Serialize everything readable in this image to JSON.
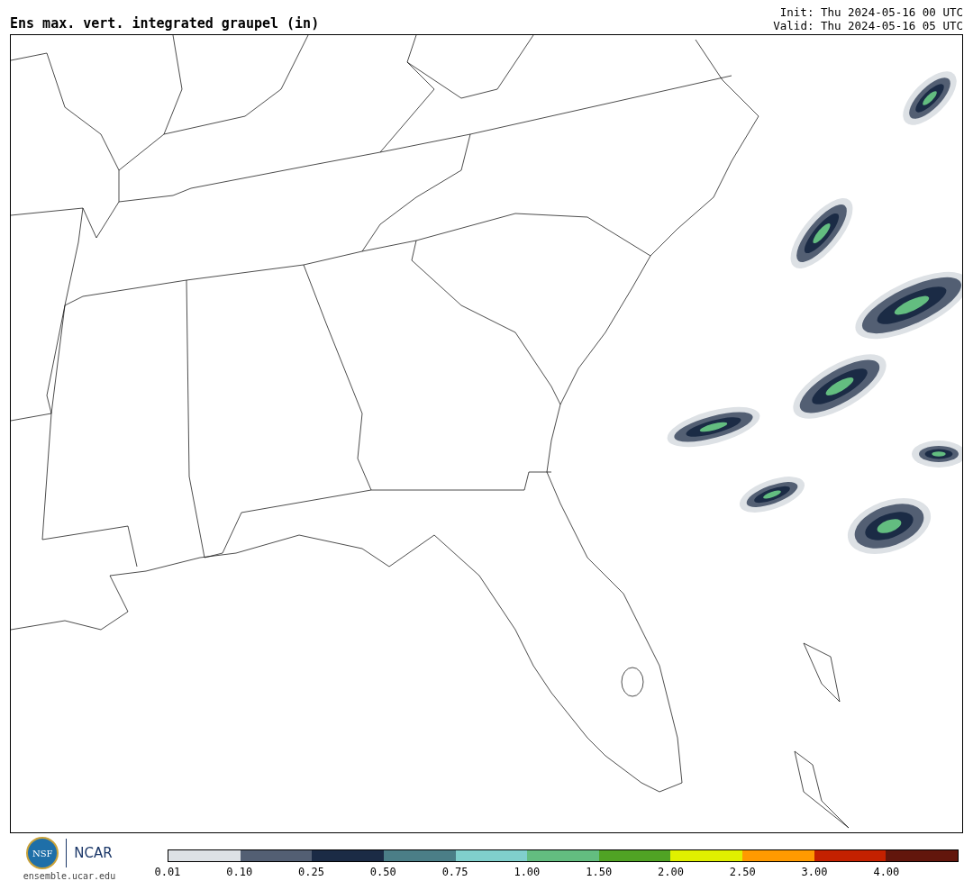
{
  "title": "Ens max. vert. integrated graupel (in)",
  "init": "Init: Thu 2024-05-16 00 UTC",
  "valid": "Valid: Thu 2024-05-16 05 UTC",
  "logo": {
    "nsf": "NSF",
    "ncar": "NCAR"
  },
  "site": "ensemble.ucar.edu",
  "colorbar": [
    {
      "label": "0.01",
      "color": "#dde1e5"
    },
    {
      "label": "0.10",
      "color": "#535f73"
    },
    {
      "label": "0.25",
      "color": "#1b2b45"
    },
    {
      "label": "0.50",
      "color": "#4b7e87"
    },
    {
      "label": "0.75",
      "color": "#80cfcc"
    },
    {
      "label": "1.00",
      "color": "#63bd80"
    },
    {
      "label": "1.50",
      "color": "#50a324"
    },
    {
      "label": "2.00",
      "color": "#e0f000"
    },
    {
      "label": "2.50",
      "color": "#ff9a00"
    },
    {
      "label": "3.00",
      "color": "#c42100"
    },
    {
      "label": "4.00",
      "color": "#62160c"
    }
  ]
}
